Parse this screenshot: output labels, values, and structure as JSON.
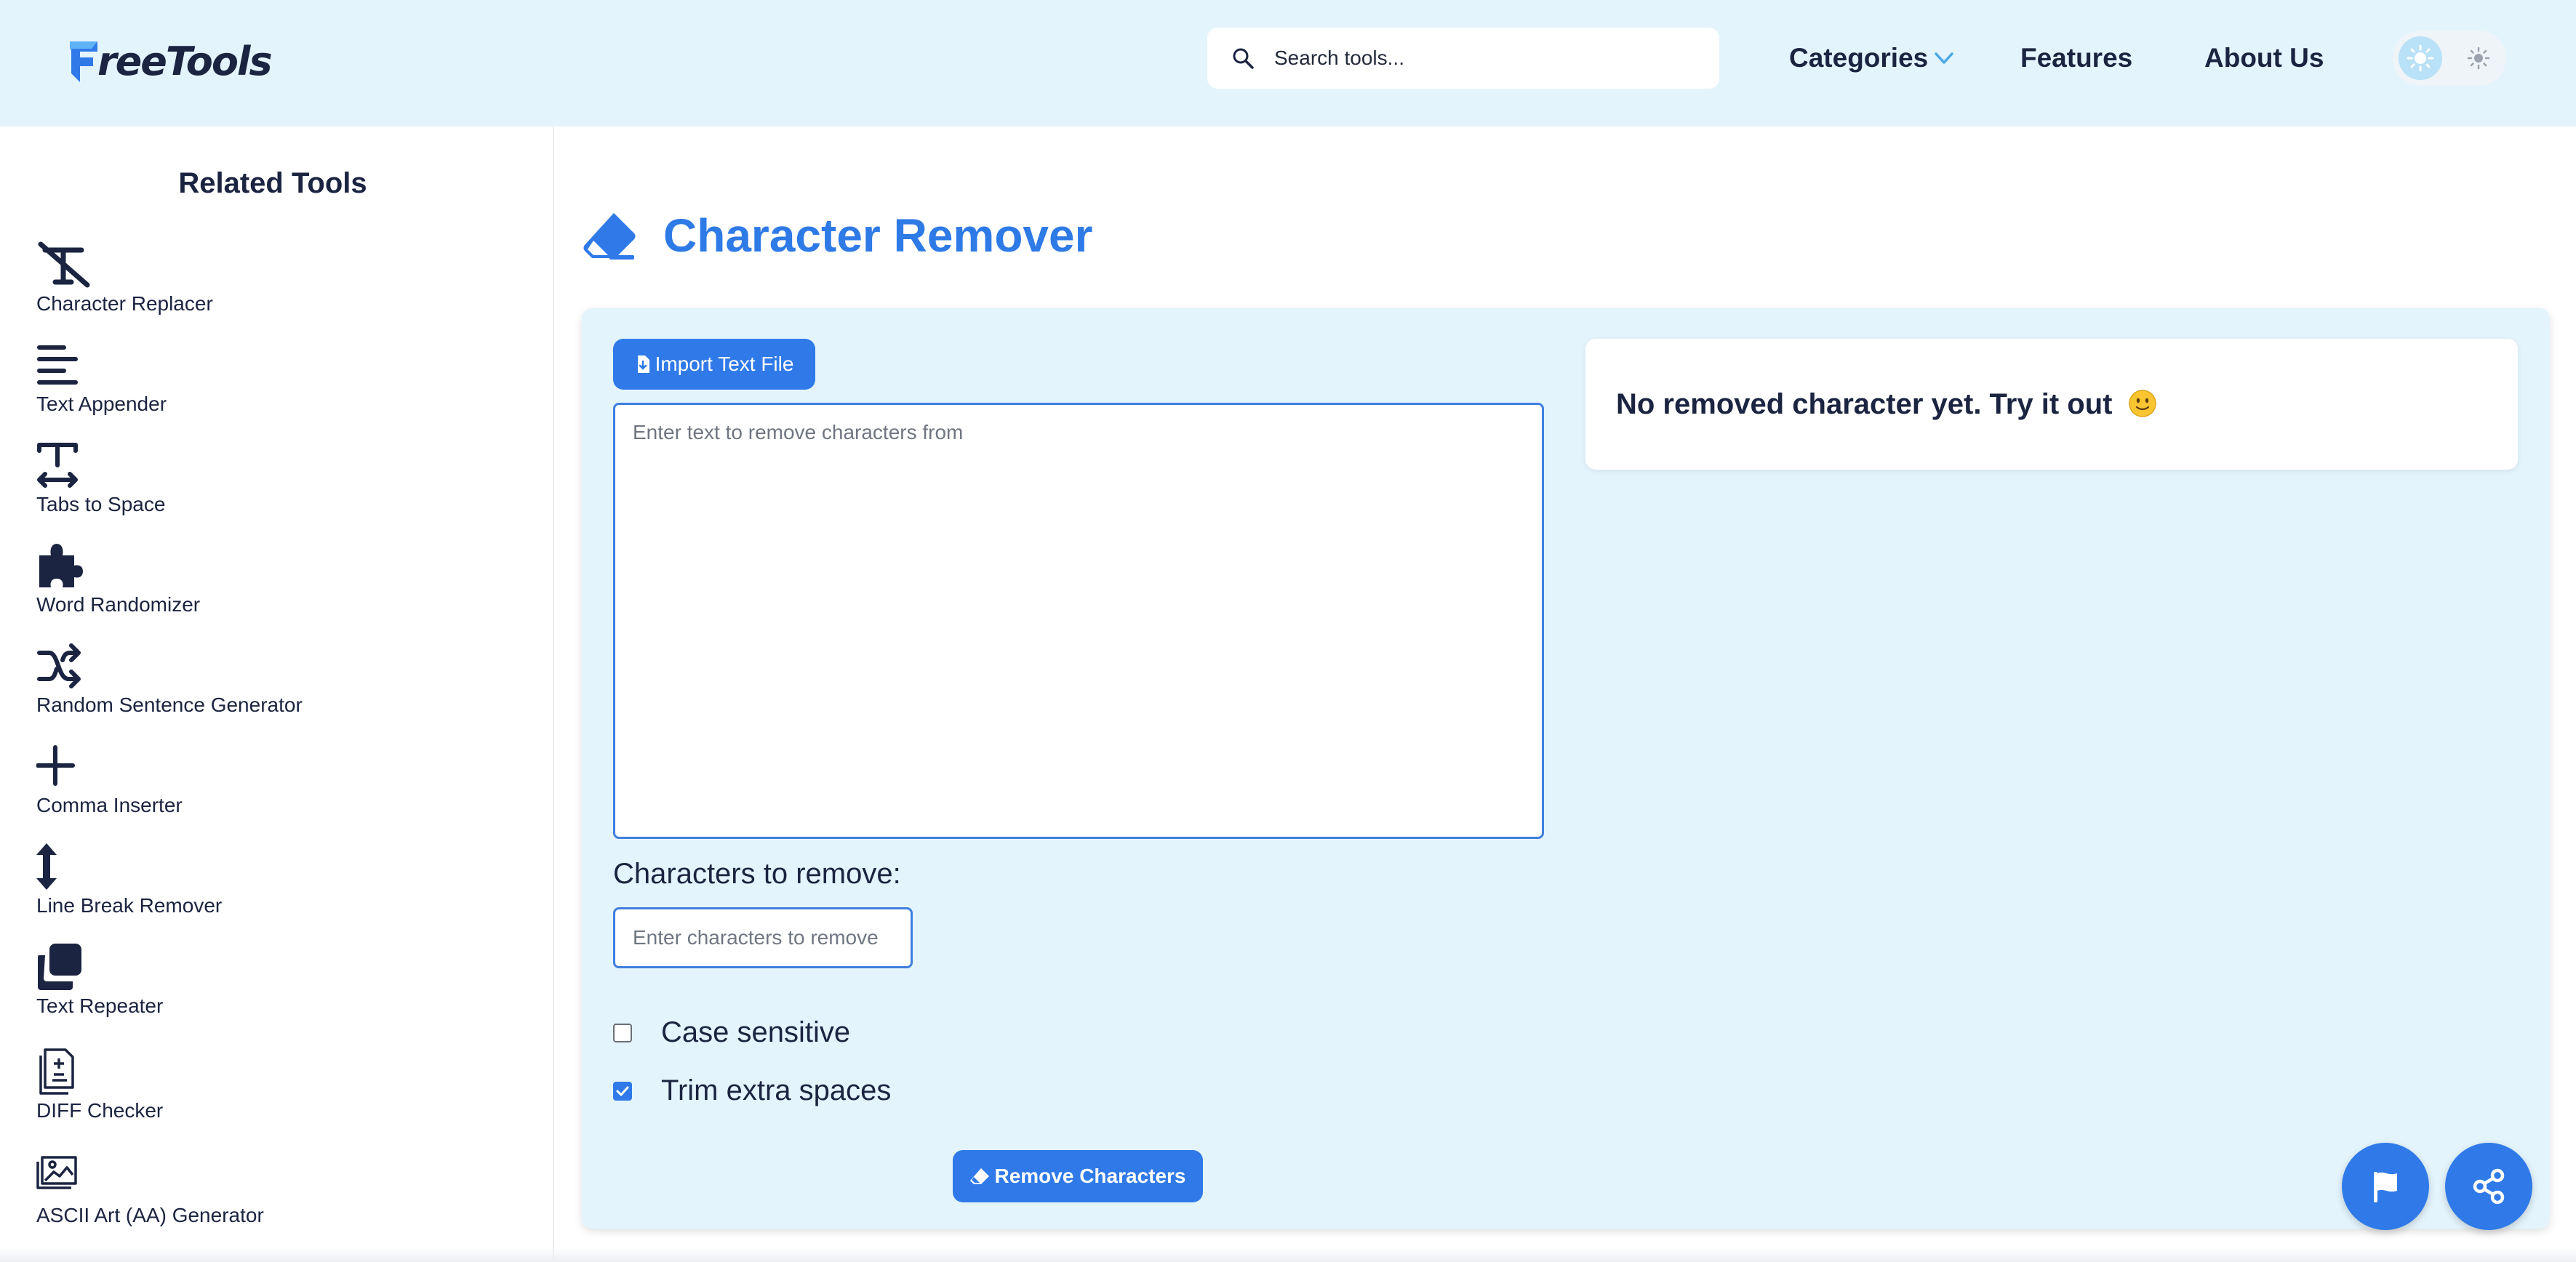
{
  "brand": {
    "logo_text": "reeTools",
    "accent_color": "#2f7ae8",
    "header_bg": "#e4f4fc"
  },
  "header": {
    "search_placeholder": "Search tools...",
    "nav": {
      "categories": "Categories",
      "features": "Features",
      "about": "About Us"
    },
    "theme_toggle": {
      "light_icon": "sun-icon",
      "dark_icon": "moon-icon",
      "active": "light"
    }
  },
  "sidebar": {
    "title": "Related Tools",
    "items": [
      {
        "label": "Character Replacer",
        "icon": "text-slash-icon"
      },
      {
        "label": "Text Appender",
        "icon": "align-left-icon"
      },
      {
        "label": "Tabs to Space",
        "icon": "text-width-icon"
      },
      {
        "label": "Word Randomizer",
        "icon": "puzzle-piece-icon"
      },
      {
        "label": "Random Sentence Generator",
        "icon": "shuffle-icon"
      },
      {
        "label": "Comma Inserter",
        "icon": "plus-icon"
      },
      {
        "label": "Line Break Remover",
        "icon": "arrows-up-down-icon"
      },
      {
        "label": "Text Repeater",
        "icon": "clone-icon"
      },
      {
        "label": "DIFF Checker",
        "icon": "file-diff-icon"
      },
      {
        "label": "ASCII Art (AA) Generator",
        "icon": "image-ascii-icon"
      }
    ]
  },
  "main": {
    "title": "Character Remover",
    "title_icon": "eraser-icon",
    "import_button": "Import Text File",
    "text_placeholder": "Enter text to remove characters from",
    "text_value": "",
    "chars_label": "Characters to remove:",
    "chars_placeholder": "Enter characters to remove",
    "chars_value": "",
    "options": {
      "case_sensitive": {
        "label": "Case sensitive",
        "checked": false
      },
      "trim_spaces": {
        "label": "Trim extra spaces",
        "checked": true
      }
    },
    "remove_button": "Remove Characters",
    "result_message": "No removed character yet. Try it out",
    "result_emoji": "slightly-smiling-face"
  },
  "floating_buttons": {
    "report": "flag-icon",
    "share": "share-icon"
  }
}
